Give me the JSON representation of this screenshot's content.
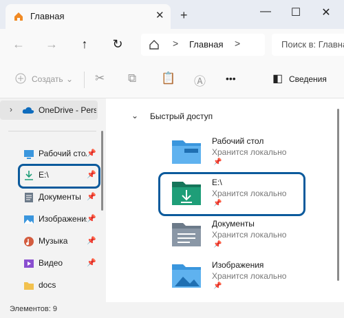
{
  "window": {
    "tab_title": "Главная",
    "new_tab": "+",
    "close_tab": "✕",
    "minimize": "—",
    "maximize": "☐",
    "close": "✕"
  },
  "nav": {
    "back": "←",
    "forward": "→",
    "up": "↑",
    "refresh": "↻",
    "breadcrumb": "Главная",
    "chevron": ">",
    "search_placeholder": "Поиск в: Главная"
  },
  "toolbar": {
    "create_label": "Создать",
    "more": "•••",
    "details_label": "Сведения"
  },
  "sidebar": {
    "onedrive": "OneDrive - Personal",
    "items": [
      {
        "label": "Рабочий стол",
        "icon": "desktop-icon",
        "pinned": true
      },
      {
        "label": "E:\\",
        "icon": "download-drive-icon",
        "pinned": true
      },
      {
        "label": "Документы",
        "icon": "documents-icon",
        "pinned": true
      },
      {
        "label": "Изображения",
        "icon": "pictures-icon",
        "pinned": true
      },
      {
        "label": "Музыка",
        "icon": "music-icon",
        "pinned": true
      },
      {
        "label": "Видео",
        "icon": "video-icon",
        "pinned": true
      },
      {
        "label": "docs",
        "icon": "folder-icon",
        "pinned": false
      }
    ]
  },
  "main": {
    "section_title": "Быстрый доступ",
    "items": [
      {
        "name": "Рабочий стол",
        "status": "Хранится локально",
        "icon": "desktop-folder-icon"
      },
      {
        "name": "E:\\",
        "status": "Хранится локально",
        "icon": "download-folder-icon"
      },
      {
        "name": "Документы",
        "status": "Хранится локально",
        "icon": "documents-folder-icon"
      },
      {
        "name": "Изображения",
        "status": "Хранится локально",
        "icon": "pictures-folder-icon"
      }
    ]
  },
  "status_bar": {
    "item_count": "Элементов: 9"
  },
  "colors": {
    "accent": "#0b5a9c",
    "folder_blue": "#3a96dd",
    "folder_teal": "#1e9e78"
  }
}
